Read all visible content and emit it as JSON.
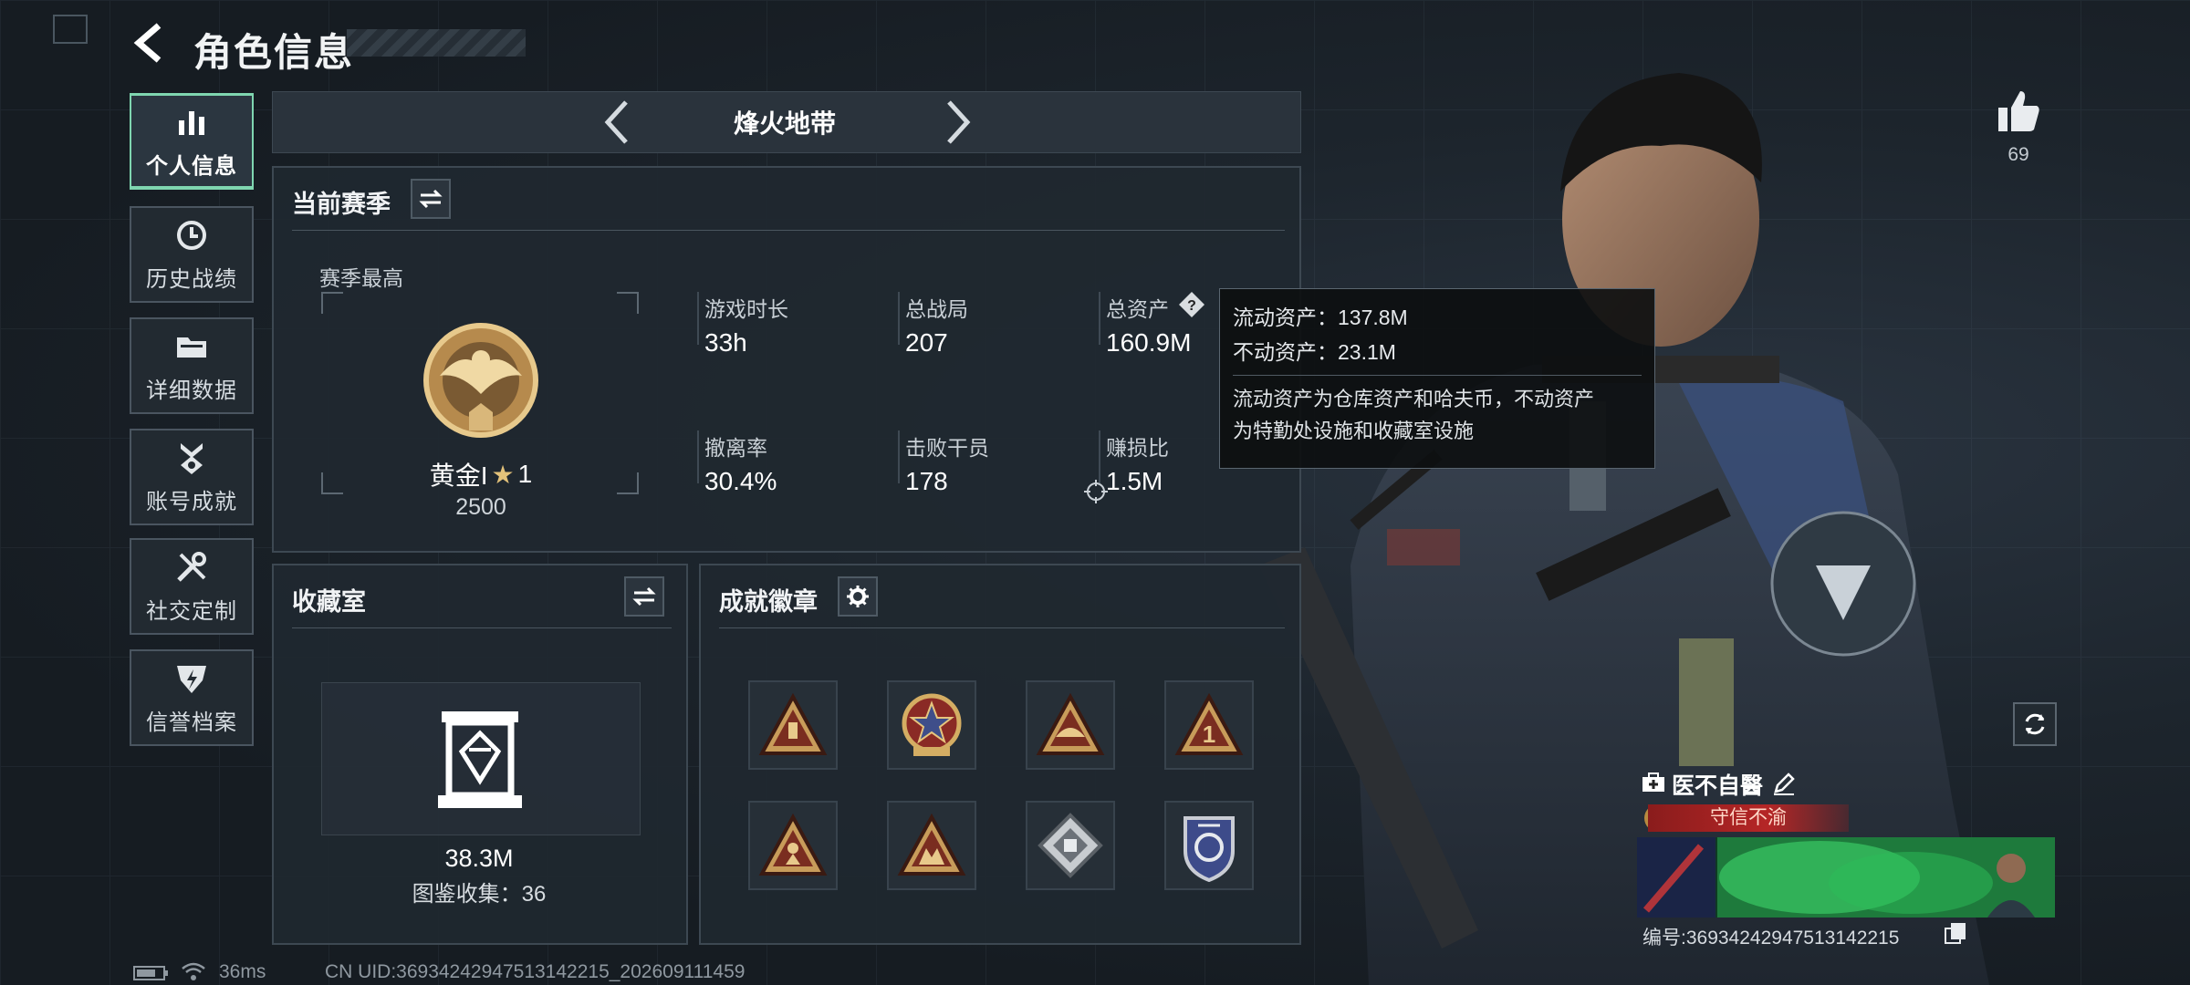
{
  "header": {
    "title": "角色信息"
  },
  "sidebar": {
    "items": [
      {
        "label": "个人信息",
        "icon": "bar-chart-icon",
        "active": true
      },
      {
        "label": "历史战绩",
        "icon": "clock-icon",
        "active": false
      },
      {
        "label": "详细数据",
        "icon": "folder-icon",
        "active": false
      },
      {
        "label": "账号成就",
        "icon": "medal-icon",
        "active": false
      },
      {
        "label": "社交定制",
        "icon": "tools-icon",
        "active": false
      },
      {
        "label": "信誉档案",
        "icon": "shield-bolt-icon",
        "active": false
      }
    ]
  },
  "mode": {
    "title": "烽火地带"
  },
  "season": {
    "title": "当前赛季",
    "best_label": "赛季最高",
    "rank_name": "黄金I",
    "rank_stars": "1",
    "rank_points": "2500",
    "stats": [
      {
        "label": "游戏时长",
        "value": "33h"
      },
      {
        "label": "总战局",
        "value": "207"
      },
      {
        "label": "总资产",
        "value": "160.9M"
      },
      {
        "label": "撤离率",
        "value": "30.4%"
      },
      {
        "label": "击败干员",
        "value": "178"
      },
      {
        "label": "赚损比",
        "value": "1.5M"
      }
    ]
  },
  "tooltip": {
    "liquid": "流动资产：137.8M",
    "fixed": "不动资产：23.1M",
    "desc_line1": "流动资产为仓库资产和哈夫币，不动资产",
    "desc_line2": "为特勤处设施和收藏室设施"
  },
  "collection": {
    "title": "收藏室",
    "value": "38.3M",
    "catalog": "图鉴收集：36"
  },
  "achievements": {
    "title": "成就徽章",
    "badges": [
      "badge-icon",
      "badge-icon",
      "badge-icon",
      "badge-icon",
      "badge-icon",
      "badge-icon",
      "badge-icon",
      "badge-icon"
    ]
  },
  "right": {
    "likes": "69",
    "player_name": "医不自醫",
    "title_banner": "守信不渝",
    "player_id": "编号:3693424294751314​2215"
  },
  "status_bar": {
    "ping": "36ms",
    "uid": "CN UID:369342429475131422​15_202609111459"
  },
  "colors": {
    "accent": "#7fd6b0",
    "panel": "#202830",
    "banner": "#b52626",
    "gold": "#c9a25a"
  }
}
